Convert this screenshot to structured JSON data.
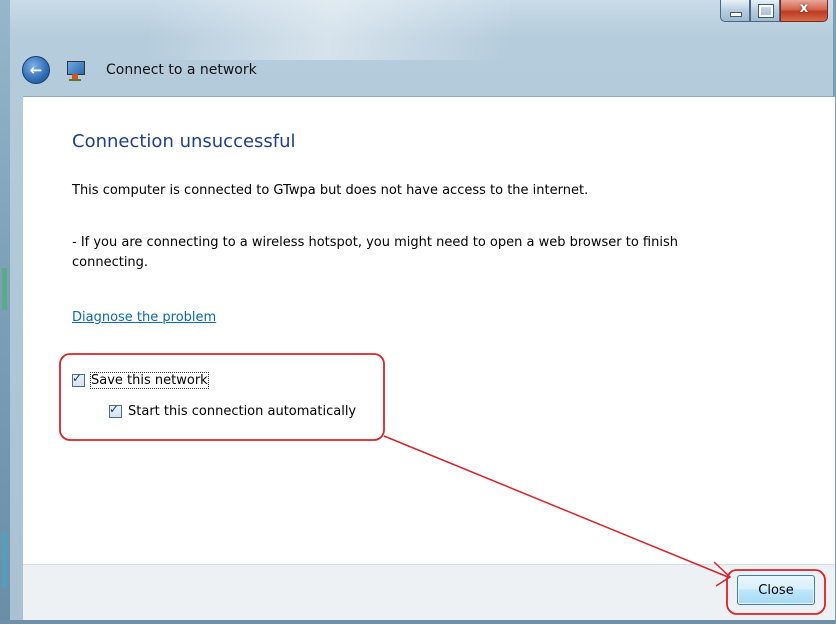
{
  "window": {
    "title": "Connect to a network",
    "caption": {
      "minimize": "–",
      "maximize": "□",
      "close": "x"
    }
  },
  "main": {
    "heading": "Connection unsuccessful",
    "message": "This computer is connected to GTwpa but does not have access to the internet.",
    "hint": "- If you are connecting to a wireless hotspot, you might need to open a web browser to finish connecting.",
    "diagnose_link": "Diagnose the problem",
    "options": [
      {
        "label": "Save this network",
        "checked": true
      },
      {
        "label": "Start this connection automatically",
        "checked": true
      }
    ]
  },
  "footer": {
    "close_label": "Close"
  },
  "annotation": {
    "color": "#d8232a"
  }
}
